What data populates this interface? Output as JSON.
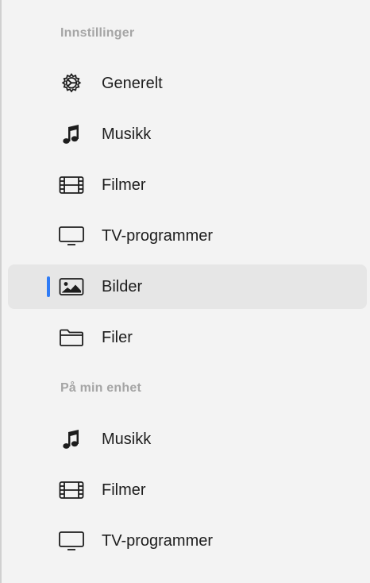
{
  "sidebar": {
    "settings_section": {
      "title": "Innstillinger",
      "items": [
        {
          "label": "Generelt",
          "icon": "gear-icon",
          "selected": false
        },
        {
          "label": "Musikk",
          "icon": "music-note-icon",
          "selected": false
        },
        {
          "label": "Filmer",
          "icon": "film-icon",
          "selected": false
        },
        {
          "label": "TV-programmer",
          "icon": "tv-icon",
          "selected": false
        },
        {
          "label": "Bilder",
          "icon": "photo-icon",
          "selected": true
        },
        {
          "label": "Filer",
          "icon": "folder-icon",
          "selected": false
        }
      ]
    },
    "device_section": {
      "title": "På min enhet",
      "items": [
        {
          "label": "Musikk",
          "icon": "music-note-icon",
          "selected": false
        },
        {
          "label": "Filmer",
          "icon": "film-icon",
          "selected": false
        },
        {
          "label": "TV-programmer",
          "icon": "tv-icon",
          "selected": false
        }
      ]
    }
  },
  "colors": {
    "background": "#f3f3f3",
    "selected_background": "#e6e6e6",
    "selection_indicator": "#2f7cf6",
    "section_header_text": "#a5a5a5",
    "item_text": "#1d1d1d"
  }
}
